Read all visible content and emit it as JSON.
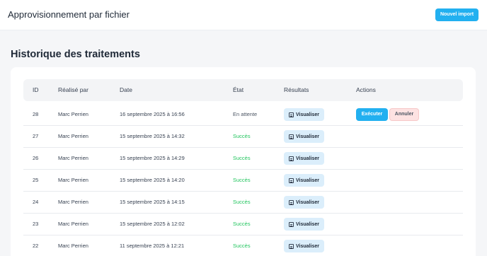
{
  "header": {
    "title": "Approvisionnement par fichier",
    "new_import_label": "Nouvel import"
  },
  "history": {
    "title": "Historique des traitements",
    "columns": [
      "ID",
      "Réalisé par",
      "Date",
      "État",
      "Résultats",
      "Actions"
    ],
    "view_label": "Visualiser",
    "execute_label": "Exécuter",
    "cancel_label": "Annuler",
    "rows": [
      {
        "id": "28",
        "user": "Marc Perrien",
        "date": "16 septembre 2025 à 16:56",
        "state": "En attente"
      },
      {
        "id": "27",
        "user": "Marc Perrien",
        "date": "15 septembre 2025 à 14:32",
        "state": "Succès"
      },
      {
        "id": "26",
        "user": "Marc Perrien",
        "date": "15 septembre 2025 à 14:29",
        "state": "Succès"
      },
      {
        "id": "25",
        "user": "Marc Perrien",
        "date": "15 septembre 2025 à 14:20",
        "state": "Succès"
      },
      {
        "id": "24",
        "user": "Marc Perrien",
        "date": "15 septembre 2025 à 14:15",
        "state": "Succès"
      },
      {
        "id": "23",
        "user": "Marc Perrien",
        "date": "15 septembre 2025 à 12:02",
        "state": "Succès"
      },
      {
        "id": "22",
        "user": "Marc Perrien",
        "date": "11 septembre 2025 à 12:21",
        "state": "Succès"
      }
    ]
  },
  "colors": {
    "accent": "#22b0f0",
    "success": "#22c55e",
    "view_button_bg": "#dbeefb",
    "cancel_button_bg": "#fde2e2"
  }
}
